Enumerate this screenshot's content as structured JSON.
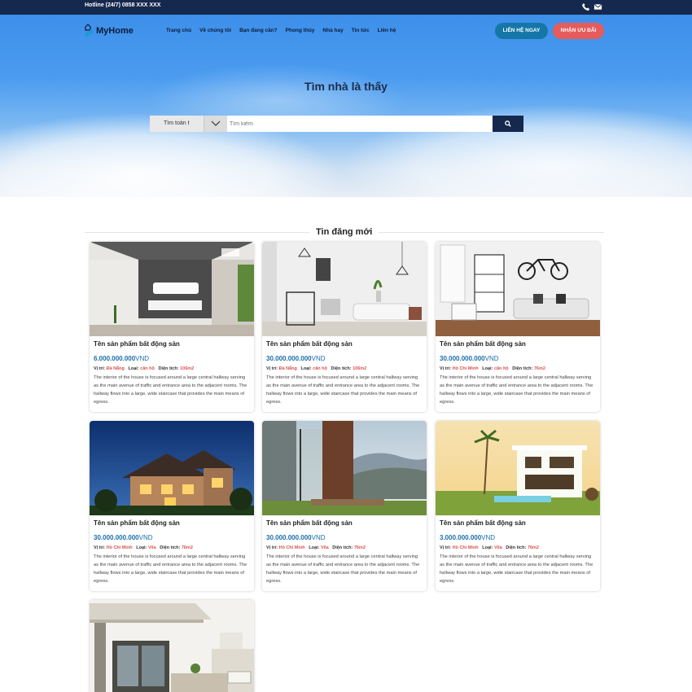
{
  "topbar": {
    "hotline": "Hotline (24/7) 0858 XXX XXX",
    "icons": [
      "phone-icon",
      "mail-icon"
    ]
  },
  "header": {
    "logo_text": "MyHome",
    "nav": [
      "Trang chủ",
      "Về chúng tôi",
      "Bạn đang cần?",
      "Phong thủy",
      "Nhà hay",
      "Tin tức",
      "Liên hệ"
    ],
    "contact_button": "LIÊN HỆ NGAY",
    "offer_button": "NHẬN ƯU ĐÃI"
  },
  "hero": {
    "title": "Tìm nhà là thấy",
    "search": {
      "select_value": "Tìm toàn t",
      "placeholder": "Tìm kiếm"
    }
  },
  "section": {
    "title": "Tin đăng mới"
  },
  "labels": {
    "location": "Vị trí:",
    "type": "Loại:",
    "area": "Diện tích:"
  },
  "listings": [
    {
      "name": "Tên sản phẩm bất động sản",
      "price": "6.000.000.000",
      "currency": "VND",
      "location": "Đà Nẵng",
      "type": "căn hộ",
      "area": "106m2",
      "description": "The interior of the house is focused around a large central hallway serving as the main avenue of traffic and entrance area to the adjacent rooms. The hallway flows into a large, wide staircase that provides the main means of egress."
    },
    {
      "name": "Tên sản phẩm bất động sản",
      "price": "30.000.000.000",
      "currency": "VND",
      "location": "Đà Nẵng",
      "type": "căn hộ",
      "area": "106m2",
      "description": "The interior of the house is focused around a large central hallway serving as the main avenue of traffic and entrance area to the adjacent rooms. The hallway flows into a large, wide staircase that provides the main means of egress."
    },
    {
      "name": "Tên sản phẩm bất động sản",
      "price": "30.000.000.000",
      "currency": "VND",
      "location": "Hồ Chí Minh",
      "type": "căn hộ",
      "area": "76m2",
      "description": "The interior of the house is focused around a large central hallway serving as the main avenue of traffic and entrance area to the adjacent rooms. The hallway flows into a large, wide staircase that provides the main means of egress."
    },
    {
      "name": "Tên sản phẩm bất động sản",
      "price": "30.000.000.000",
      "currency": "VND",
      "location": "Hồ Chí Minh",
      "type": "Vila",
      "area": "76m2",
      "description": "The interior of the house is focused around a large central hallway serving as the main avenue of traffic and entrance area to the adjacent rooms. The hallway flows into a large, wide staircase that provides the main means of egress."
    },
    {
      "name": "Tên sản phẩm bất động sản",
      "price": "30.000.000.000",
      "currency": "VND",
      "location": "Hồ Chí Minh",
      "type": "Vila",
      "area": "76m2",
      "description": "The interior of the house is focused around a large central hallway serving as the main avenue of traffic and entrance area to the adjacent rooms. The hallway flows into a large, wide staircase that provides the main means of egress."
    },
    {
      "name": "Tên sản phẩm bất động sản",
      "price": "3.000.000.000",
      "currency": "VND",
      "location": "Hồ Chí Minh",
      "type": "Vila",
      "area": "76m2",
      "description": "The interior of the house is focused around a large central hallway serving as the main avenue of traffic and entrance area to the adjacent rooms. The hallway flows into a large, wide staircase that provides the main means of egress."
    }
  ],
  "colors": {
    "topbar": "#15284d",
    "contact_button": "#1577a8",
    "offer_button": "#e65b5b",
    "price": "#1a6ea8",
    "meta_value": "#d9534f"
  }
}
